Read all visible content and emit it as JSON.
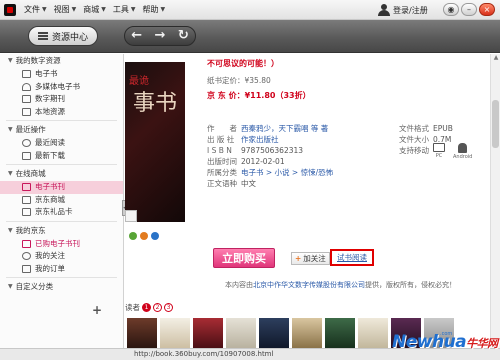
{
  "menubar": {
    "items": [
      "文件",
      "视图",
      "商城",
      "工具",
      "帮助"
    ],
    "login": "登录/注册"
  },
  "window_buttons": {
    "settings": "◉",
    "minimize": "–",
    "maximize": "□",
    "close": "×"
  },
  "toolbar": {
    "resource_center": "资源中心",
    "back": "←",
    "forward": "→",
    "refresh": "↻"
  },
  "sidebar": {
    "sections": [
      {
        "title": "我的数字资源",
        "items": [
          "电子书",
          "多媒体电子书",
          "数字期刊",
          "本地资源"
        ]
      },
      {
        "title": "最近操作",
        "items": [
          "最近阅读",
          "最新下载"
        ]
      },
      {
        "title": "在线商城",
        "items": [
          "电子书刊",
          "京东商城",
          "京东礼品卡"
        ]
      },
      {
        "title": "我的京东",
        "items": [
          "已购电子书刊",
          "我的关注",
          "我的订单"
        ]
      },
      {
        "title": "自定义分类",
        "items": []
      }
    ],
    "add": "+"
  },
  "book": {
    "headline": "不可思议的可能！）",
    "paper_price_label": "纸书定价：",
    "paper_price": "¥35.80",
    "jd_price_label": "京 东 价：",
    "jd_price": "¥11.80",
    "discount": "（33折）",
    "info": [
      {
        "label": "作　　者",
        "value": "西秦鸦少，天下霸唱 等 著"
      },
      {
        "label": "出 版 社",
        "value": "作家出版社"
      },
      {
        "label": "I S B N",
        "value": "9787506362313"
      },
      {
        "label": "出版时间",
        "value": "2012-02-01"
      },
      {
        "label": "所属分类",
        "value": "电子书 > 小说 > 惊悚/恐怖"
      },
      {
        "label": "正文语种",
        "value": "中文"
      }
    ],
    "meta": [
      {
        "label": "文件格式",
        "value": "EPUB"
      },
      {
        "label": "文件大小",
        "value": "0.7M"
      },
      {
        "label": "支持移动",
        "value": ""
      }
    ],
    "devices": [
      "PC",
      "Android"
    ],
    "cover_title_small": "最诡",
    "cover_title_big": "事书"
  },
  "actions": {
    "buy": "立即购买",
    "follow": "加关注",
    "trial": "试书阅读"
  },
  "copyright": {
    "prefix": "本内容由",
    "publisher": "北京中作华文数字传媒股份有限公司",
    "suffix": "提供，版权所有，侵权必究！"
  },
  "pager": {
    "pages": [
      "1",
      "2",
      "3"
    ],
    "prefix": "读者"
  },
  "status": {
    "url": "http://book.360buy.com/10907008.html"
  },
  "watermark": {
    "brand": "Newhua",
    "cn": "牛华网",
    "domain": ".com"
  },
  "colors": {
    "accent_pink": "#e0367a",
    "price_red": "#d0021b",
    "link_blue": "#2b5aa8",
    "toolbar_dark": "#5a5a5a"
  }
}
